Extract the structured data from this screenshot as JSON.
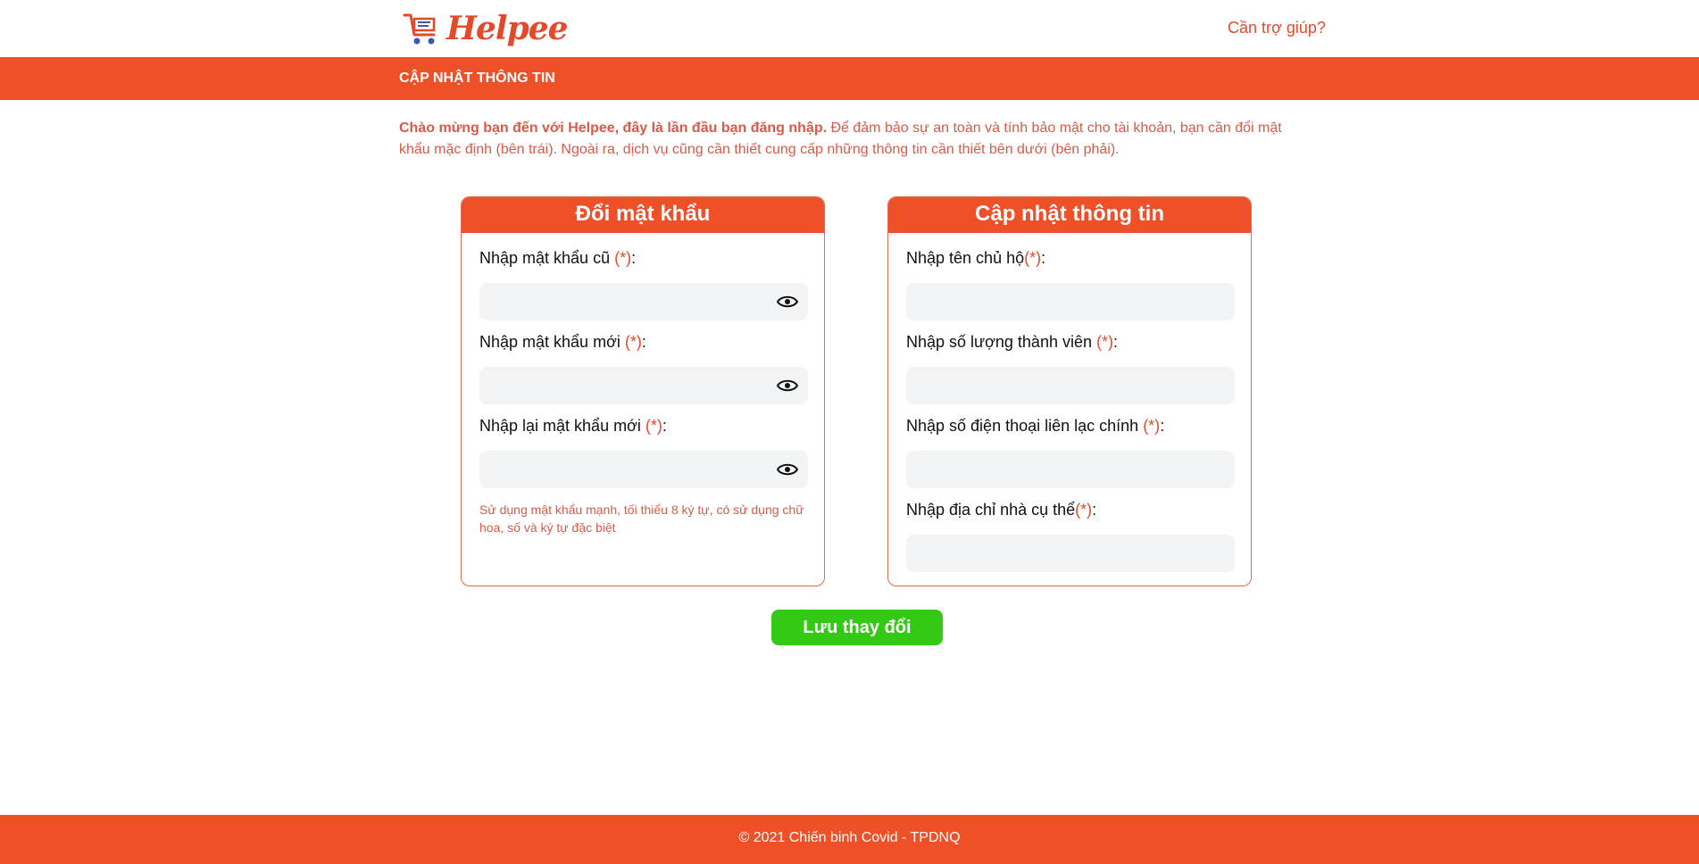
{
  "header": {
    "logo_text": "Helpee",
    "help_link": "Cần trợ giúp?"
  },
  "banner": {
    "title": "CẬP NHẬT THÔNG TIN"
  },
  "intro": {
    "bold": "Chào mừng bạn đến với Helpee, đây là lần đầu bạn đăng nhập.",
    "text": " Để đảm bảo sự an toàn và tính bảo mật cho tài khoản, bạn cần đổi mật khẩu mặc định (bên trái). Ngoài ra, dịch vụ cũng cần thiết cung cấp những thông tin cần thiết bên dưới (bên phải)."
  },
  "password_card": {
    "title": "Đổi mật khẩu",
    "fields": [
      {
        "label": "Nhập mật khẩu cũ ",
        "required": "(*)",
        "suffix": ":",
        "value": ""
      },
      {
        "label": "Nhập mật khẩu mới ",
        "required": "(*)",
        "suffix": ":",
        "value": ""
      },
      {
        "label": "Nhập lại mật khẩu mới ",
        "required": "(*)",
        "suffix": ":",
        "value": ""
      }
    ],
    "hint": "Sử dụng mật khẩu mạnh, tối thiểu 8 ký tự, có sử dụng chữ hoa, số và ký tự đặc biệt"
  },
  "info_card": {
    "title": "Cập nhật thông tin",
    "fields": [
      {
        "label": "Nhập tên chủ hộ",
        "required": "(*)",
        "suffix": ":",
        "value": ""
      },
      {
        "label": "Nhập số lượng thành viên ",
        "required": "(*)",
        "suffix": ":",
        "value": ""
      },
      {
        "label": "Nhập số điện thoại liên lạc chính ",
        "required": "(*)",
        "suffix": ":",
        "value": ""
      },
      {
        "label": "Nhập địa chỉ nhà cụ thể",
        "required": "(*)",
        "suffix": ":",
        "value": ""
      }
    ]
  },
  "save_button": "Lưu thay đổi",
  "footer": {
    "text": "© 2021 Chiến binh Covid - TPDNQ"
  },
  "colors": {
    "primary": "#ee5028",
    "accent_text": "#d75a4a",
    "save_green": "#33c914",
    "input_bg": "#f2f4f5"
  },
  "icons": {
    "logo": "shopping-cart-icon",
    "password_toggle": "eye-icon"
  }
}
